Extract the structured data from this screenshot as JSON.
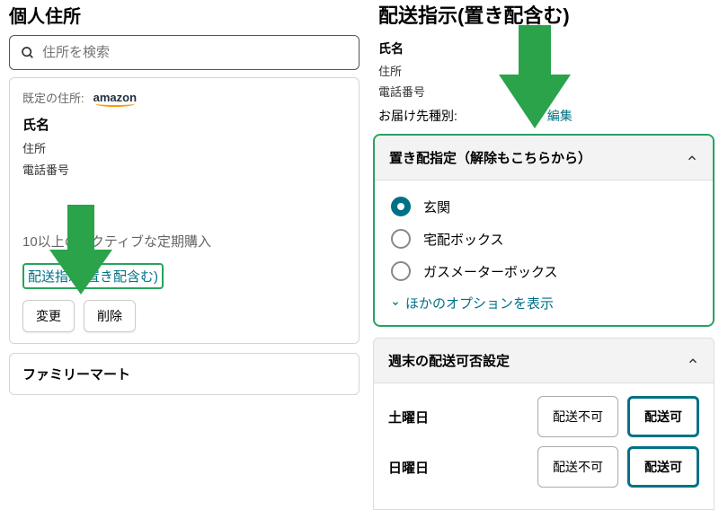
{
  "left": {
    "title": "個人住所",
    "search_placeholder": "住所を検索",
    "default_label": "既定の住所:",
    "logo_text": "amazon",
    "name": "氏名",
    "address": "住所",
    "phone": "電話番号",
    "subs_line": "10以上のアクティブな定期購入",
    "delivery_link": "配送指示(置き配含む)",
    "change_btn": "変更",
    "delete_btn": "削除",
    "store_name": "ファミリーマート"
  },
  "right": {
    "title": "配送指示(置き配含む)",
    "name_label": "氏名",
    "address_line": "住所",
    "phone_line": "電話番号",
    "delivery_type_label": "お届け先種別:",
    "edit_link": "編集",
    "okihai_title": "置き配指定（解除もこちらから）",
    "options": [
      {
        "label": "玄関",
        "checked": true
      },
      {
        "label": "宅配ボックス",
        "checked": false
      },
      {
        "label": "ガスメーターボックス",
        "checked": false
      }
    ],
    "more_options": "ほかのオプションを表示",
    "weekend_title": "週末の配送可否設定",
    "sat_label": "土曜日",
    "sun_label": "日曜日",
    "no_delivery": "配送不可",
    "yes_delivery": "配送可"
  }
}
